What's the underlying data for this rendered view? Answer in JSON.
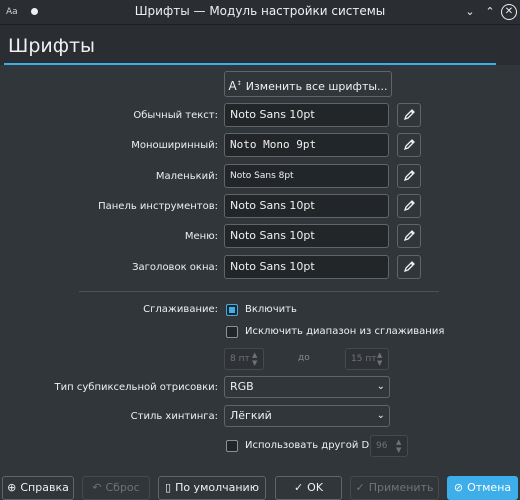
{
  "window": {
    "app_icon_text": "Aa",
    "title": "Шрифты — Модуль настройки системы"
  },
  "page": {
    "title": "Шрифты"
  },
  "change_all_button": {
    "label": "Изменить все шрифты..."
  },
  "font_rows": [
    {
      "label": "Обычный текст:",
      "value": "Noto Sans 10pt"
    },
    {
      "label": "Моноширинный:",
      "value": "Noto Mono 9pt"
    },
    {
      "label": "Маленький:",
      "value": "Noto Sans 8pt"
    },
    {
      "label": "Панель инструментов:",
      "value": "Noto Sans 10pt"
    },
    {
      "label": "Меню:",
      "value": "Noto Sans 10pt"
    },
    {
      "label": "Заголовок окна:",
      "value": "Noto Sans 10pt"
    }
  ],
  "antialiasing": {
    "label": "Сглаживание:",
    "enable_label": "Включить",
    "enable_checked": true,
    "exclude_label": "Исключить диапазон из сглаживания",
    "exclude_checked": false,
    "range_from": "8 пт",
    "range_to_label": "до",
    "range_to": "15 пт"
  },
  "subpixel": {
    "label": "Тип субпиксельной отрисовки:",
    "value": "RGB"
  },
  "hinting": {
    "label": "Стиль хинтинга:",
    "value": "Лёгкий"
  },
  "dpi": {
    "label": "Использовать другой DPI:",
    "checked": false,
    "value": "96"
  },
  "footer": {
    "help": "Справка",
    "reset": "Сброс",
    "defaults": "По умолчанию",
    "ok": "OK",
    "apply": "Применить",
    "cancel": "Отмена"
  },
  "colors": {
    "accent": "#3daee9",
    "background": "#31363b"
  }
}
